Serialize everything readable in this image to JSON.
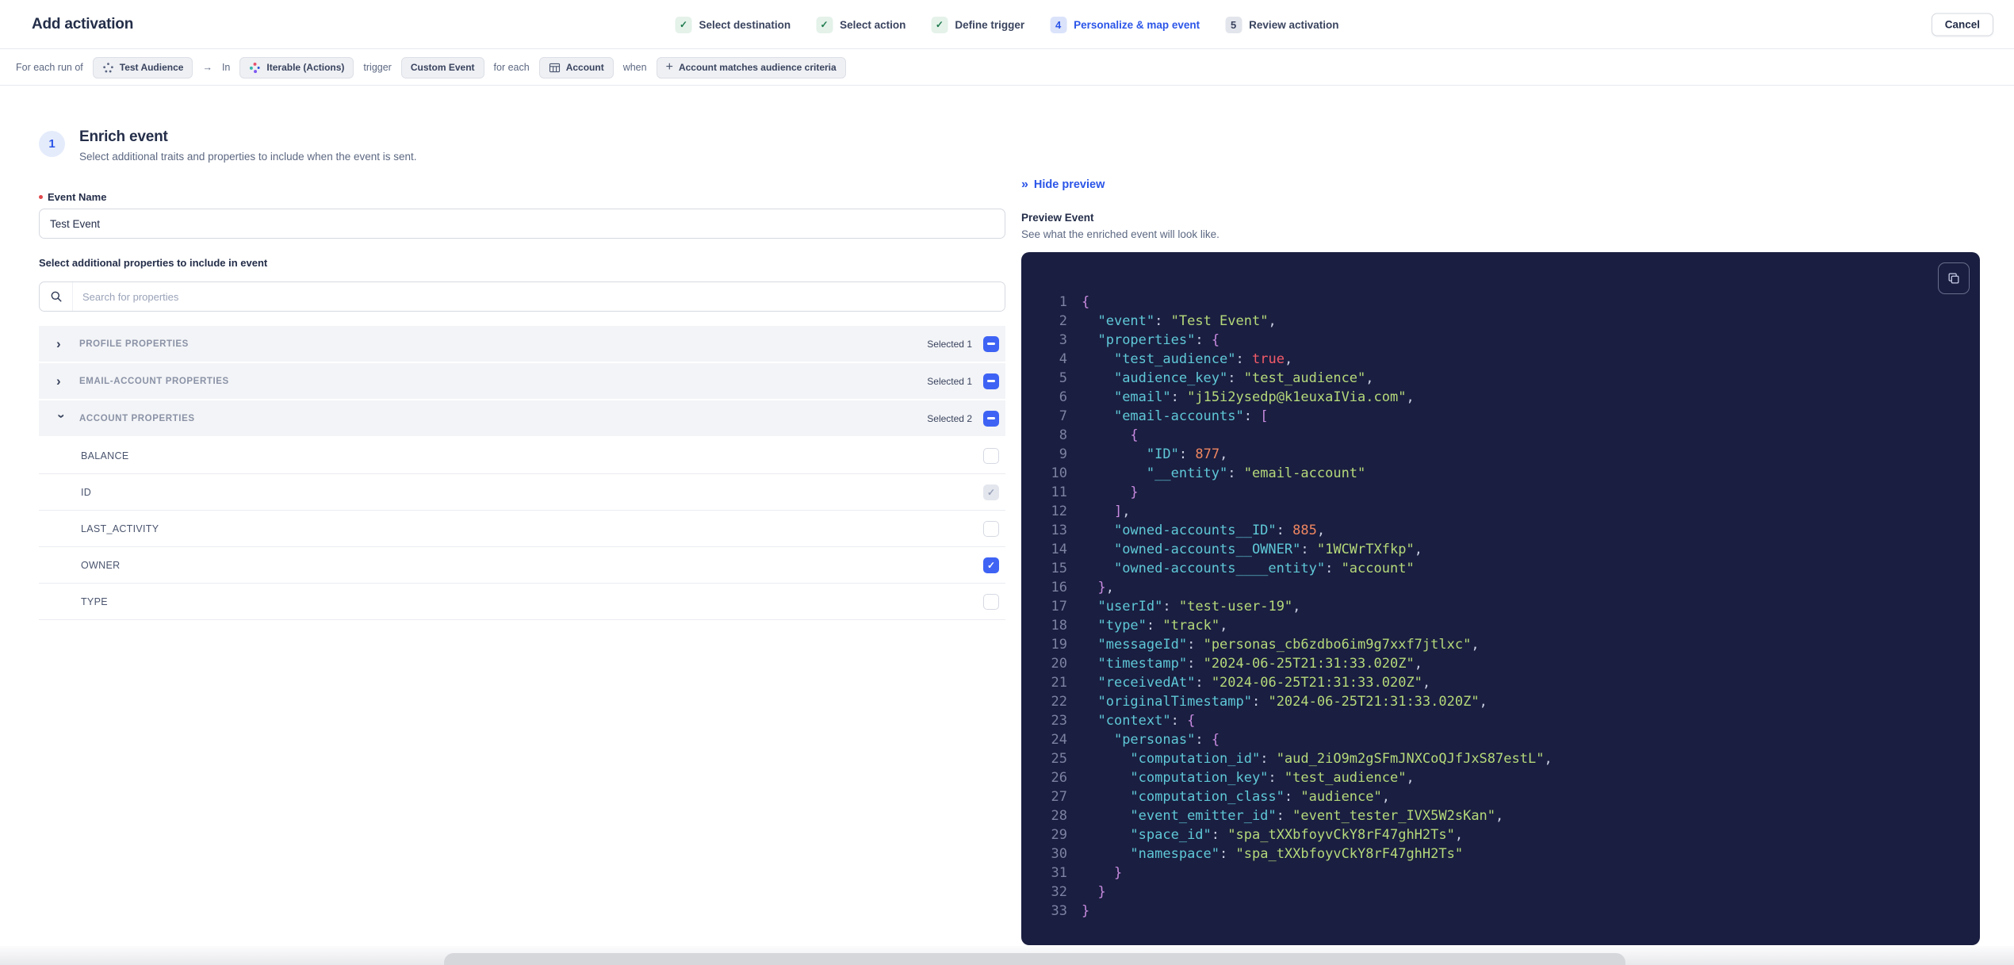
{
  "header": {
    "title": "Add activation",
    "cancel_label": "Cancel",
    "steps": [
      {
        "label": "Select destination",
        "state": "done"
      },
      {
        "label": "Select action",
        "state": "done"
      },
      {
        "label": "Define trigger",
        "state": "done"
      },
      {
        "label": "Personalize & map event",
        "state": "active",
        "number": "4"
      },
      {
        "label": "Review activation",
        "state": "upcoming",
        "number": "5"
      }
    ]
  },
  "context_bar": {
    "segments": [
      {
        "type": "text",
        "text": "For each run of"
      },
      {
        "type": "chip",
        "text": "Test Audience",
        "icon": "audience-icon"
      },
      {
        "type": "text",
        "text": "→"
      },
      {
        "type": "text",
        "text": "In"
      },
      {
        "type": "chip",
        "text": "Iterable (Actions)",
        "icon": "iterable-icon"
      },
      {
        "type": "text",
        "text": "trigger"
      },
      {
        "type": "chip",
        "text": "Custom Event"
      },
      {
        "type": "text",
        "text": "for each"
      },
      {
        "type": "chip",
        "text": "Account",
        "icon": "table-icon"
      },
      {
        "type": "text",
        "text": "when"
      },
      {
        "type": "chip",
        "text": "Account matches audience criteria",
        "icon": "plus-icon"
      }
    ]
  },
  "enrich": {
    "step_number": "1",
    "title": "Enrich event",
    "subtitle": "Select additional traits and properties to include when the event is sent.",
    "event_name_label": "Event Name",
    "event_name_value": "Test Event",
    "properties_label": "Select additional properties to include in event",
    "search_placeholder": "Search for properties",
    "groups": [
      {
        "label": "PROFILE PROPERTIES",
        "selected": "Selected 1",
        "expanded": false,
        "checkbox": "indeterminate"
      },
      {
        "label": "EMAIL-ACCOUNT PROPERTIES",
        "selected": "Selected 1",
        "expanded": false,
        "checkbox": "indeterminate"
      },
      {
        "label": "ACCOUNT PROPERTIES",
        "selected": "Selected 2",
        "expanded": true,
        "checkbox": "indeterminate",
        "children": [
          {
            "label": "BALANCE",
            "state": "unchecked"
          },
          {
            "label": "ID",
            "state": "checked-disabled"
          },
          {
            "label": "LAST_ACTIVITY",
            "state": "unchecked"
          },
          {
            "label": "OWNER",
            "state": "checked"
          },
          {
            "label": "TYPE",
            "state": "unchecked"
          }
        ]
      }
    ]
  },
  "preview": {
    "hide_label": "Hide preview",
    "title": "Preview Event",
    "subtitle": "See what the enriched event will look like.",
    "code_lines": [
      "{",
      "  \"event\": \"Test Event\",",
      "  \"properties\": {",
      "    \"test_audience\": true,",
      "    \"audience_key\": \"test_audience\",",
      "    \"email\": \"j15i2ysedp@k1euxaIVia.com\",",
      "    \"email-accounts\": [",
      "      {",
      "        \"ID\": 877,",
      "        \"__entity\": \"email-account\"",
      "      }",
      "    ],",
      "    \"owned-accounts__ID\": 885,",
      "    \"owned-accounts__OWNER\": \"1WCWrTXfkp\",",
      "    \"owned-accounts____entity\": \"account\"",
      "  },",
      "  \"userId\": \"test-user-19\",",
      "  \"type\": \"track\",",
      "  \"messageId\": \"personas_cb6zdbo6im9g7xxf7jtlxc\",",
      "  \"timestamp\": \"2024-06-25T21:31:33.020Z\",",
      "  \"receivedAt\": \"2024-06-25T21:31:33.020Z\",",
      "  \"originalTimestamp\": \"2024-06-25T21:31:33.020Z\",",
      "  \"context\": {",
      "    \"personas\": {",
      "      \"computation_id\": \"aud_2iO9m2gSFmJNXCoQJfJxS87estL\",",
      "      \"computation_key\": \"test_audience\",",
      "      \"computation_class\": \"audience\",",
      "      \"event_emitter_id\": \"event_tester_IVX5W2sKan\",",
      "      \"space_id\": \"spa_tXXbfoyvCkY8rF47ghH2Ts\",",
      "      \"namespace\": \"spa_tXXbfoyvCkY8rF47ghH2Ts\"",
      "    }",
      "  }",
      "}"
    ]
  },
  "colors": {
    "accent-blue": "#2b55e8",
    "checkbox-blue": "#3e63f4",
    "success-green": "#1d7a4b",
    "success-bg": "#e4f2ea",
    "text-dark": "#242e49",
    "text-gray": "#5c6882",
    "code-bg": "#1a1e40",
    "code-key": "#5fc8d7",
    "code-string": "#b5d97a",
    "code-number": "#ef8661",
    "code-bool": "#f45b69",
    "code-brace": "#c88be0",
    "code-punct": "#ccd0e4",
    "code-linenum": "#7c82a2"
  }
}
